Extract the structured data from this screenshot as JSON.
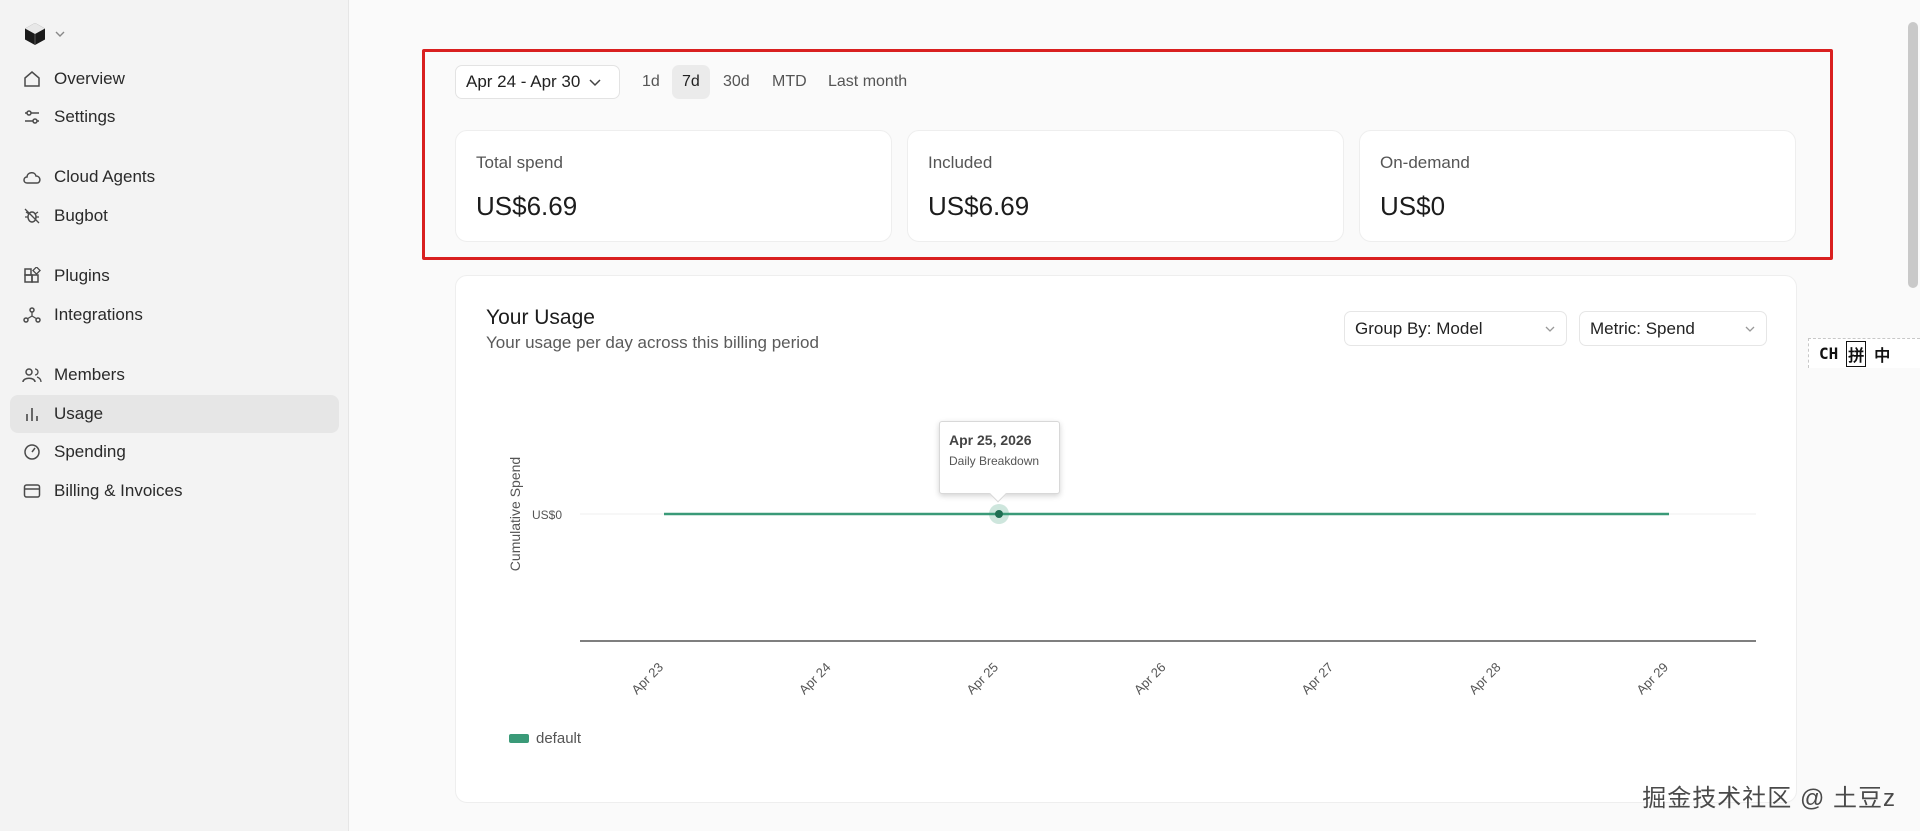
{
  "sidebar": {
    "items": [
      {
        "label": "Overview",
        "icon": "home-icon"
      },
      {
        "label": "Settings",
        "icon": "sliders-icon"
      },
      {
        "label": "Cloud Agents",
        "icon": "cloud-icon"
      },
      {
        "label": "Bugbot",
        "icon": "bug-icon"
      },
      {
        "label": "Plugins",
        "icon": "plugins-icon"
      },
      {
        "label": "Integrations",
        "icon": "integrations-icon"
      },
      {
        "label": "Members",
        "icon": "members-icon"
      },
      {
        "label": "Usage",
        "icon": "bar-chart-icon"
      },
      {
        "label": "Spending",
        "icon": "gauge-icon"
      },
      {
        "label": "Billing & Invoices",
        "icon": "card-icon"
      }
    ],
    "active": "Usage"
  },
  "filters": {
    "date_range": "Apr 24 - Apr 30",
    "ranges": [
      "1d",
      "7d",
      "30d",
      "MTD",
      "Last month"
    ],
    "active_range": "7d"
  },
  "stats": [
    {
      "label": "Total spend",
      "value": "US$6.69"
    },
    {
      "label": "Included",
      "value": "US$6.69"
    },
    {
      "label": "On-demand",
      "value": "US$0"
    }
  ],
  "usage": {
    "title": "Your Usage",
    "subtitle": "Your usage per day across this billing period",
    "group_by": "Group By: Model",
    "metric": "Metric: Spend",
    "tooltip_date": "Apr 25, 2026",
    "tooltip_sub": "Daily Breakdown"
  },
  "chart_data": {
    "type": "line",
    "ylabel": "Cumulative Spend",
    "ytick": "US$0",
    "x": [
      "Apr 23",
      "Apr 24",
      "Apr 25",
      "Apr 26",
      "Apr 27",
      "Apr 28",
      "Apr 29"
    ],
    "series": [
      {
        "name": "default",
        "values": [
          0,
          0,
          0,
          0,
          0,
          0,
          0
        ],
        "color": "#3a9a78"
      }
    ],
    "highlighted_index": 2,
    "legend": "bottom-left"
  },
  "ime": {
    "a": "CH",
    "b": "拼",
    "c": "中"
  },
  "watermark": "掘金技术社区 @ 土豆z"
}
